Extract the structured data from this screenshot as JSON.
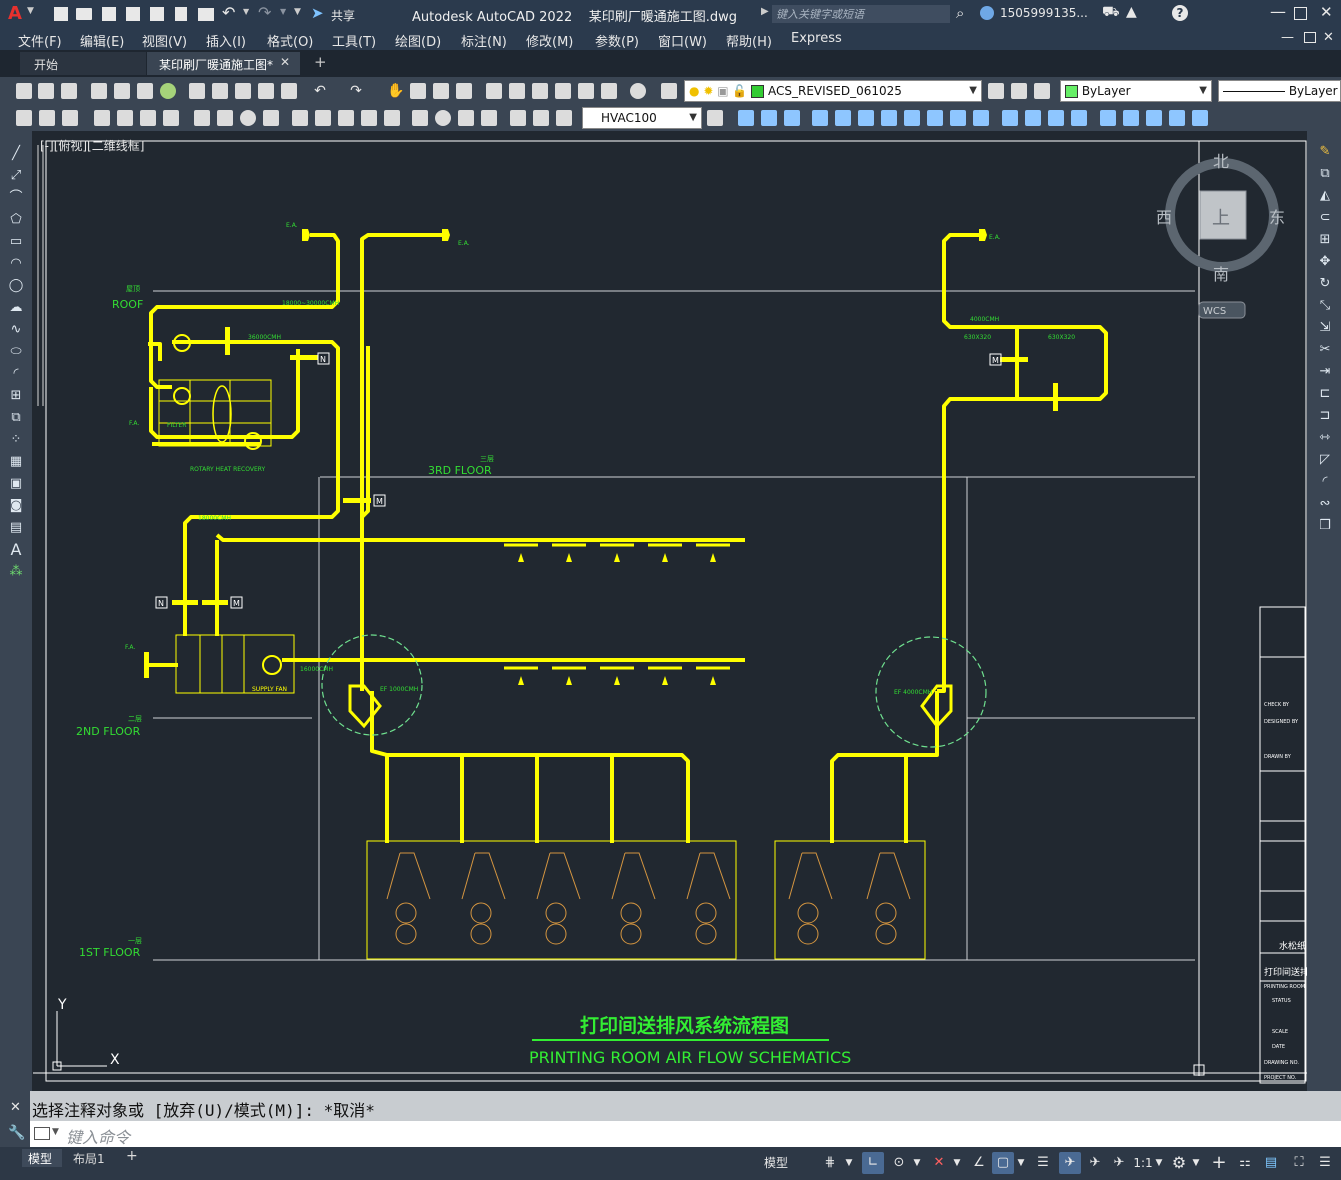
{
  "titlebar": {
    "app_logo": "A",
    "title": "Autodesk AutoCAD 2022    某印刷厂暖通施工图.dwg",
    "share_label": "共享",
    "search_placeholder": "键入关键字或短语",
    "user": "1505999135...",
    "window_controls": [
      "minimize-icon",
      "maximize-icon",
      "close-icon"
    ]
  },
  "menubar": {
    "items": [
      "文件(F)",
      "编辑(E)",
      "视图(V)",
      "插入(I)",
      "格式(O)",
      "工具(T)",
      "绘图(D)",
      "标注(N)",
      "修改(M)",
      "参数(P)",
      "窗口(W)",
      "帮助(H)",
      "Express"
    ]
  },
  "tabs": {
    "start": "开始",
    "active": "某印刷厂暖通施工图*",
    "close": "✕",
    "new": "+"
  },
  "toolbar": {
    "layer": "ACS_REVISED_061025",
    "color": "ByLayer",
    "linetype": "ByLayer",
    "dimstyle": "HVAC100"
  },
  "viewport": {
    "label": "[-][俯视][二维线框]"
  },
  "viewcube": {
    "north": "北",
    "south": "南",
    "east": "东",
    "west": "西",
    "top": "上",
    "wcs": "WCS"
  },
  "drawing": {
    "title_cn": "打印间送排风系统流程图",
    "title_en": "PRINTING ROOM AIR FLOW SCHEMATICS",
    "floor_roof_cn": "屋顶",
    "floor_roof": "ROOF",
    "floor_3_cn": "三层",
    "floor_3": "3RD FLOOR",
    "floor_2_cn": "二层",
    "floor_2": "2ND FLOOR",
    "floor_1_cn": "一层",
    "floor_1": "1ST FLOOR",
    "rotary_heat_recovery": "ROTARY HEAT RECOVERY",
    "ea_1": "E.A.",
    "ea_2": "E.A.",
    "ea_3": "E.A.",
    "fa_1": "F.A.",
    "fa_2": "F.A.",
    "filter": "FILTER",
    "supply_fan": "SUPPLY FAN",
    "ef_1": "EF 1000CMH",
    "ef_2": "EF 4000CMH",
    "flow_1": "18000~30000CMH",
    "flow_2": "36000CMH",
    "flow_3": "18000CMH",
    "flow_4": "4000CMH",
    "flow_5": "16000CMH",
    "size_1": "630X320",
    "size_2": "630X320",
    "damper_n": "N",
    "damper_m": "M",
    "axis_y": "Y",
    "axis_x": "X",
    "tb_designer": "DESIGNED BY",
    "tb_drawn": "DRAWN BY",
    "tb_check": "CHECK BY",
    "tb_paper": "水松纸",
    "tb_room": "打印间送排",
    "tb_room_en": "PRINTING ROOM",
    "tb_status": "STATUS",
    "tb_scale": "SCALE",
    "tb_date": "DATE",
    "tb_drawing_no": "DRAWING NO.",
    "tb_project_no": "PROJECT NO."
  },
  "command": {
    "history": "选择注释对象或 [放弃(U)/模式(M)]: *取消*",
    "placeholder": "键入命令"
  },
  "layout_tabs": [
    "模型",
    "布局1",
    "+"
  ],
  "statusbar": {
    "model": "模型",
    "scale": "1:1"
  }
}
